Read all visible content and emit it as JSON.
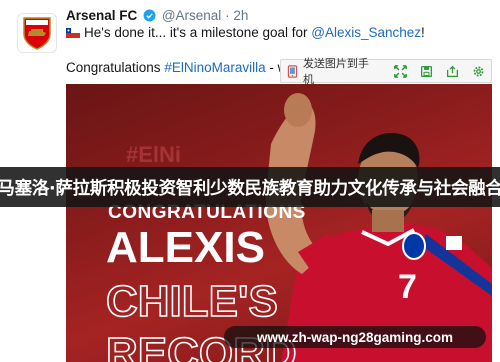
{
  "tweet": {
    "display_name": "Arsenal FC",
    "handle": "@Arsenal",
    "separator": "·",
    "time": "2h",
    "text_prefix": "He's done it... it's a milestone goal for",
    "mention": "@Alexis_Sanchez",
    "text_suffix": "!",
    "line2_prefix": "Congratulations",
    "hashtag": "#ElNinoMaravilla",
    "line2_suffix": "- we're"
  },
  "toolbar": {
    "send_label": "发送图片到手机",
    "icons": [
      "phone-send-icon",
      "expand-icon",
      "save-icon",
      "share-icon",
      "settings-icon"
    ]
  },
  "media": {
    "headline_small": "CONGRATULATIONS",
    "headline_name": "ALEXIS",
    "headline_line3": "CHILE'S",
    "headline_line4": "RECORD",
    "jersey_number": "7",
    "faded_text": "#ElNi"
  },
  "banner": {
    "text": "马塞洛·萨拉斯积极投资智利少数民族教育助力文化传承与社会融合"
  },
  "watermark": {
    "text": "www.zh-wap-ng28gaming.com"
  },
  "colors": {
    "link": "#1b6cc2",
    "arsenal_red": "#db0007",
    "chile_red": "#d52b1e",
    "chile_blue": "#0039a6"
  }
}
